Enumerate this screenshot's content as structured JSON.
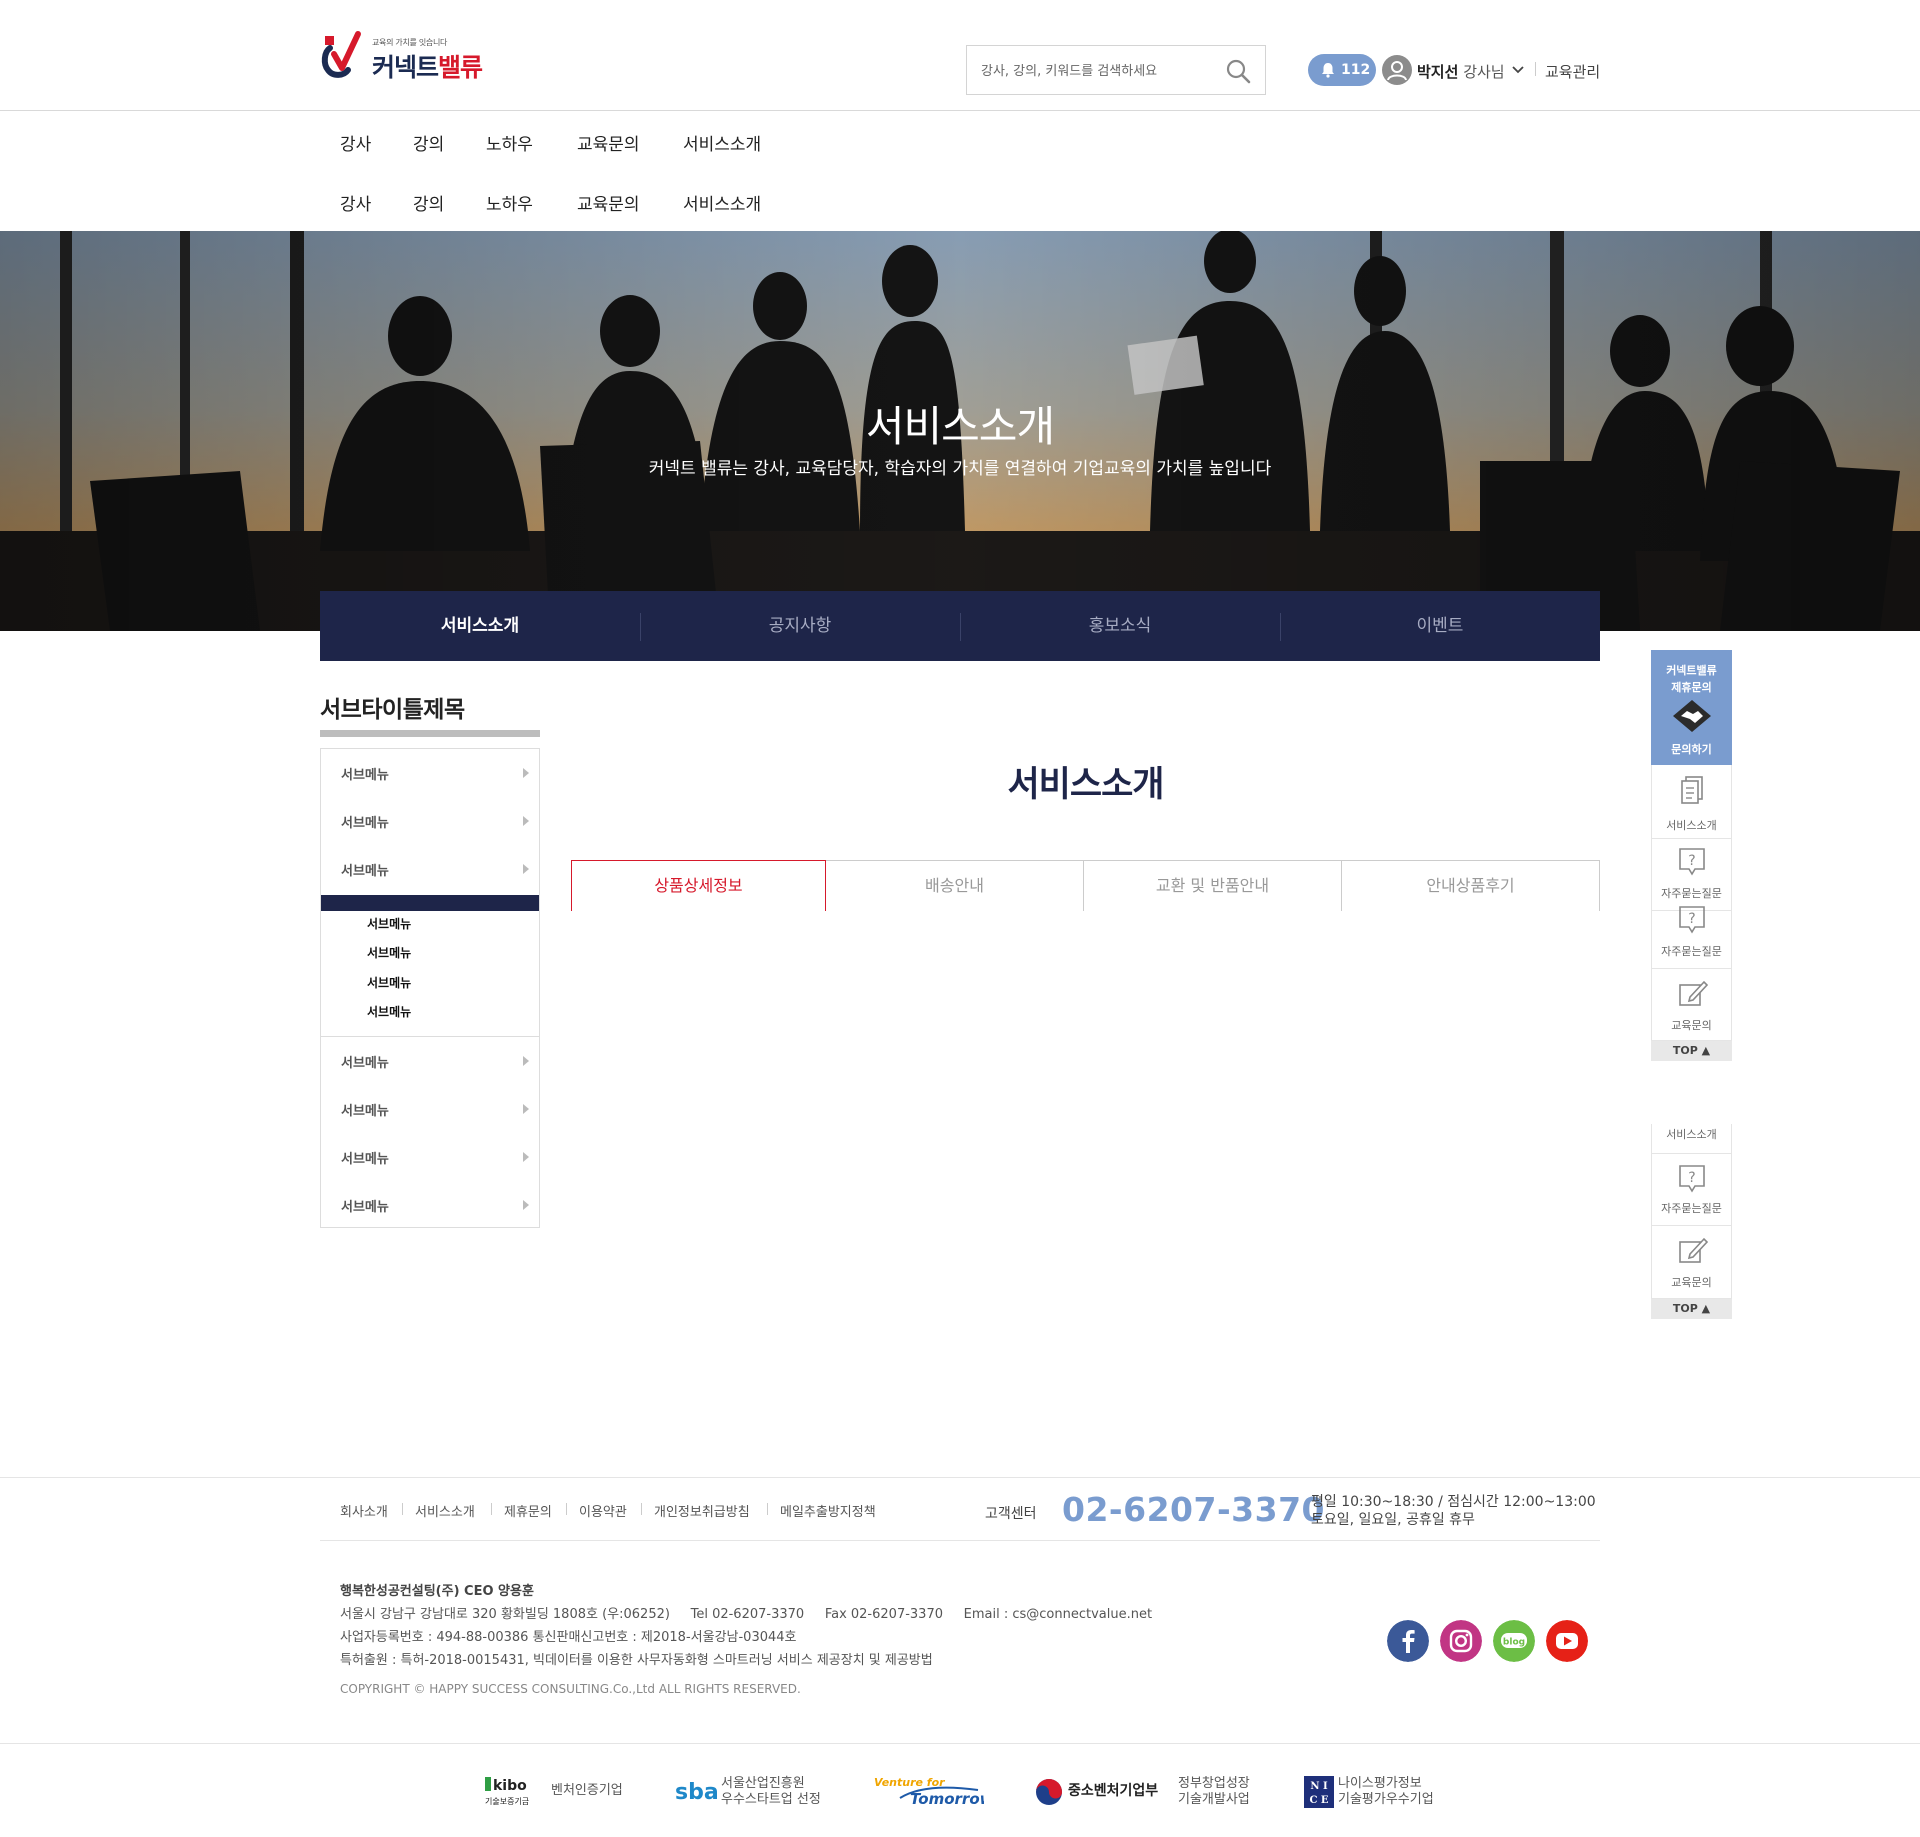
{
  "header": {
    "logo_tagline": "교육의 가치를 잇습니다",
    "logo_name_a": "커넥트",
    "logo_name_b": "밸류",
    "search_placeholder": "강사, 강의, 키워드를 검색하세요",
    "notification_count": "112",
    "user_name": "박지선",
    "user_role": "강사님",
    "edu_manage": "교육관리"
  },
  "gnb_rows": [
    [
      "강사",
      "강의",
      "노하우",
      "교육문의",
      "서비스소개"
    ],
    [
      "강사",
      "강의",
      "노하우",
      "교육문의",
      "서비스소개"
    ]
  ],
  "hero": {
    "title": "서비스소개",
    "subtitle": "커넥트 밸류는 강사, 교육담당자, 학습자의 가치를 연결하여 기업교육의 가치를 높입니다"
  },
  "tabbar": [
    "서비스소개",
    "공지사항",
    "홍보소식",
    "이벤트"
  ],
  "lnb": {
    "title": "서브타이틀제목",
    "items_top": [
      "서브메뉴",
      "서브메뉴",
      "서브메뉴"
    ],
    "sub_items": [
      "서브메뉴",
      "서브메뉴",
      "서브메뉴",
      "서브메뉴"
    ],
    "items_bottom": [
      "서브메뉴",
      "서브메뉴",
      "서브메뉴",
      "서브메뉴"
    ]
  },
  "content": {
    "title": "서비스소개",
    "tabs": [
      "상품상세정보",
      "배송안내",
      "교환 및 반품안내",
      "안내상품후기"
    ]
  },
  "quick_menu": {
    "head_line1": "커넥트밸류",
    "head_line2": "제휴문의",
    "head_action": "문의하기",
    "service": "서비스소개",
    "faq": "자주묻는질문",
    "edu_inquiry": "교육문의",
    "top": "TOP ▲"
  },
  "footer": {
    "menu": [
      "회사소개",
      "서비스소개",
      "제휴문의",
      "이용약관",
      "개인정보취급방침",
      "메일추출방지정책"
    ],
    "cs_label": "고객센터",
    "cs_phone": "02-6207-3370",
    "cs_hours_1": "평일 10:30~18:30 / 점심시간 12:00~13:00",
    "cs_hours_2": "토요일, 일요일, 공휴일 휴무",
    "company_line1": "행복한성공컨설팅(주) CEO 양용훈",
    "company_line2": "서울시 강남구 강남대로 320 황화빌딩 1808호 (우:06252)     Tel 02-6207-3370     Fax 02-6207-3370     Email : cs@connectvalue.net",
    "company_line3": "사업자등록번호 : 494-88-00386 통신판매신고번호 : 제2018-서울강남-03044호",
    "company_line4": "특허출원 : 특허-2018-0015431, 빅데이터를 이용한 사무자동화형 스마트러닝 서비스 제공장치 및 제공방법",
    "copyright": "COPYRIGHT © HAPPY SUCCESS CONSULTING.Co.,Ltd ALL RIGHTS RESERVED.",
    "sns": [
      "facebook-icon",
      "instagram-icon",
      "blog-icon",
      "youtube-icon"
    ],
    "blog_label": "blog"
  },
  "certifications": [
    {
      "logo": "kibo",
      "logo_sub": "기술보증기금",
      "text1": "벤처인증기업",
      "text2": ""
    },
    {
      "logo": "sba",
      "text1": "서울산업진흥원",
      "text2": "우수스타트업 선정"
    },
    {
      "logo_top": "Venture for",
      "logo": "Tomorrow",
      "text1": "",
      "text2": ""
    },
    {
      "logo": "중소벤처기업부",
      "text1": "정부창업성장",
      "text2": "기술개발사업"
    },
    {
      "logo_a": "N I",
      "logo_b": "C E",
      "text1": "나이스평가정보",
      "text2": "기술평가우수기업"
    }
  ],
  "colors": {
    "navy": "#1e2549",
    "brand_red": "#d6192b",
    "accent_blue": "#7a9ccf"
  }
}
